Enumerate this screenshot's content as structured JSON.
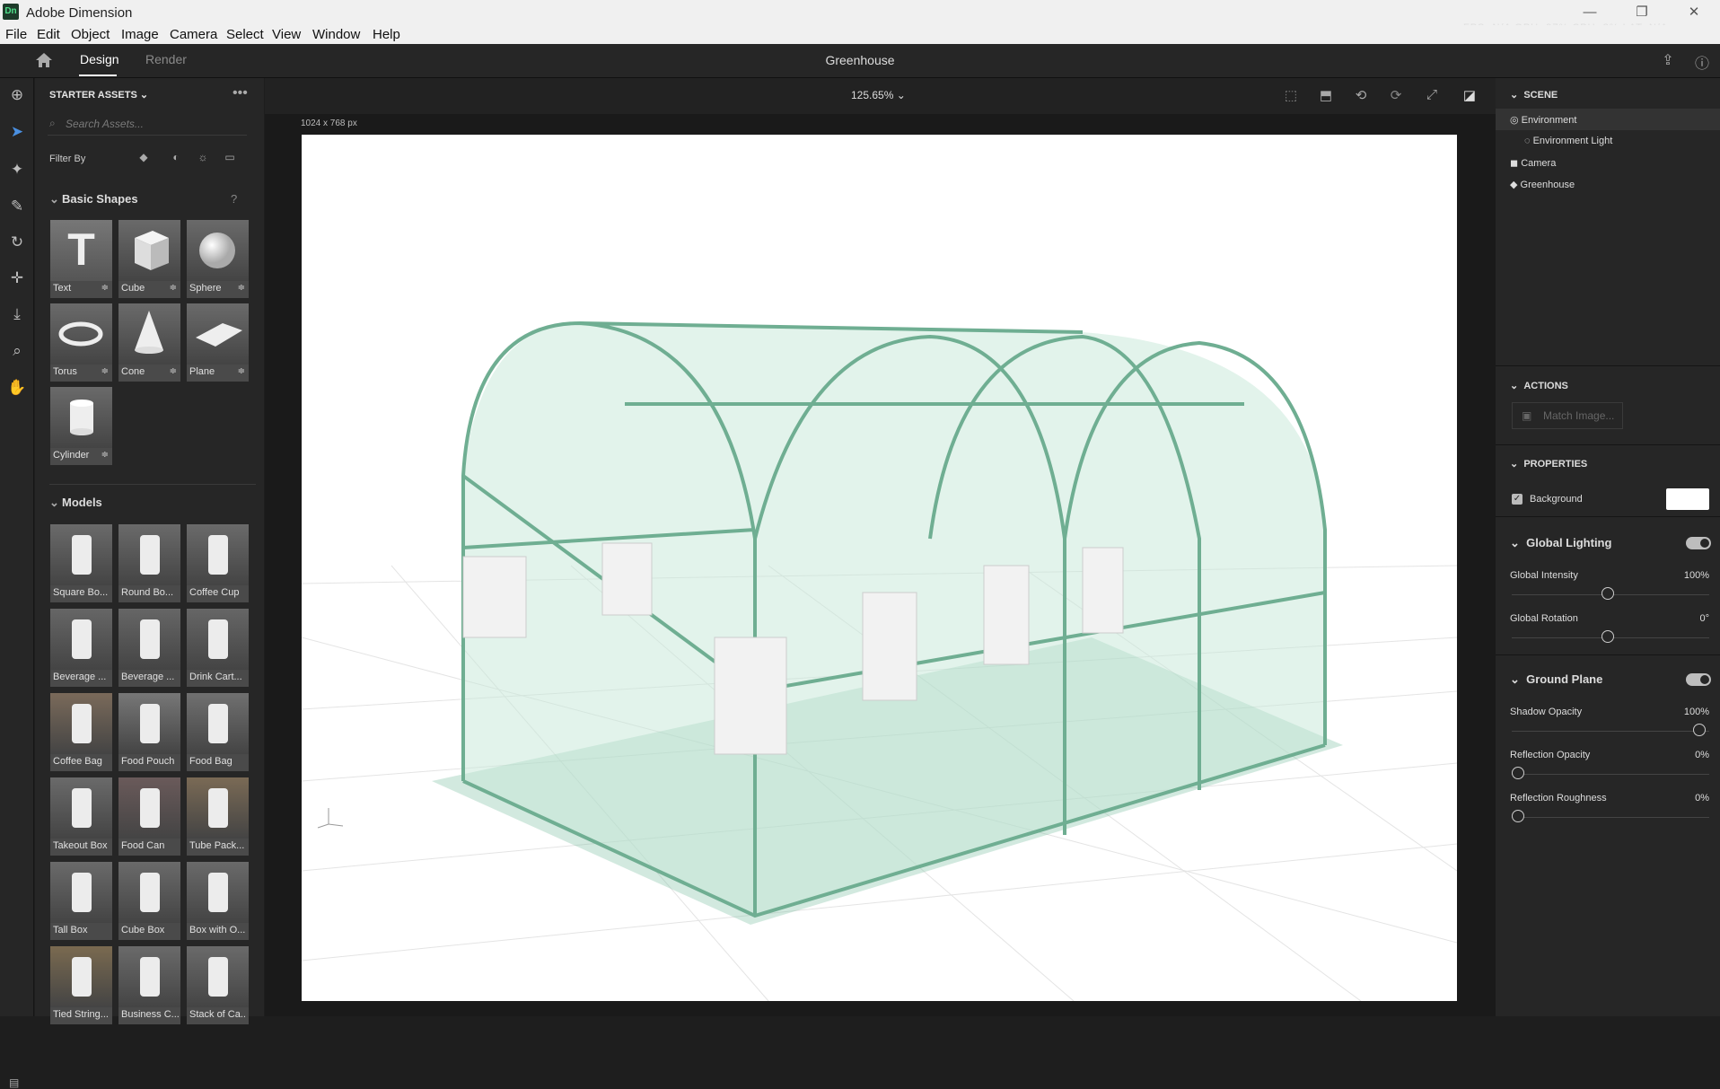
{
  "window": {
    "title": "Adobe Dimension",
    "logo": "Dn",
    "perf": "FPS: N/A GPU: 97% CPU: 8% LAT: N/A"
  },
  "menu": [
    "File",
    "Edit",
    "Object",
    "Image",
    "Camera",
    "Select",
    "View",
    "Window",
    "Help"
  ],
  "tabs": {
    "design": "Design",
    "render": "Render"
  },
  "document": {
    "title": "Greenhouse"
  },
  "assets": {
    "header": "STARTER ASSETS",
    "search_placeholder": "Search Assets...",
    "filter_label": "Filter By",
    "basic_shapes": {
      "title": "Basic Shapes",
      "items": [
        "Text",
        "Cube",
        "Sphere",
        "Torus",
        "Cone",
        "Plane",
        "Cylinder"
      ]
    },
    "models": {
      "title": "Models",
      "items": [
        "Square Bo...",
        "Round Bo...",
        "Coffee Cup",
        "Beverage ...",
        "Beverage ...",
        "Drink Cart...",
        "Coffee Bag",
        "Food Pouch",
        "Food Bag",
        "Takeout Box",
        "Food Can",
        "Tube Pack...",
        "Tall Box",
        "Cube Box",
        "Box with O...",
        "Tied String...",
        "Business C...",
        "Stack of Ca..."
      ]
    }
  },
  "canvas": {
    "zoom": "125.65%",
    "size_label": "1024 x 768 px"
  },
  "scene": {
    "header": "SCENE",
    "items": [
      {
        "label": "Environment"
      },
      {
        "label": "Environment Light"
      },
      {
        "label": "Camera"
      },
      {
        "label": "Greenhouse"
      }
    ]
  },
  "actions": {
    "header": "ACTIONS",
    "match_image": "Match Image..."
  },
  "properties": {
    "header": "PROPERTIES",
    "background_label": "Background",
    "background_color": "#ffffff",
    "global_lighting": {
      "title": "Global Lighting",
      "intensity_label": "Global Intensity",
      "intensity": "100%",
      "rotation_label": "Global Rotation",
      "rotation": "0°"
    },
    "ground_plane": {
      "title": "Ground Plane",
      "shadow_label": "Shadow Opacity",
      "shadow": "100%",
      "reflection_label": "Reflection Opacity",
      "reflection": "0%",
      "roughness_label": "Reflection Roughness",
      "roughness": "0%"
    }
  },
  "colors": {
    "accent": "#4a90e2",
    "greenhouse": "#7fbfa3"
  }
}
